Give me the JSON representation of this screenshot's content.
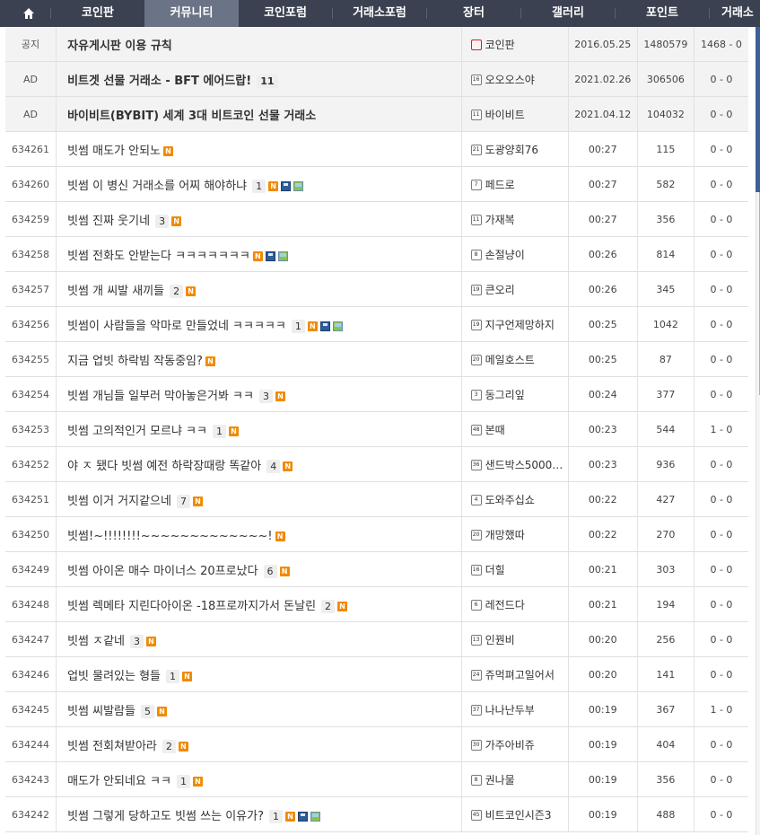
{
  "nav": {
    "items": [
      {
        "label": "코인판",
        "active": false
      },
      {
        "label": "커뮤니티",
        "active": true
      },
      {
        "label": "코인포럼",
        "active": false
      },
      {
        "label": "거래소포럼",
        "active": false
      },
      {
        "label": "장터",
        "active": false
      },
      {
        "label": "갤러리",
        "active": false
      },
      {
        "label": "포인트",
        "active": false
      },
      {
        "label": "거래소",
        "active": false
      }
    ]
  },
  "posts": [
    {
      "num": "공지",
      "title": "자유게시판 이용 규칙",
      "comments": "",
      "icons": [],
      "level": "ad",
      "author": "코인판",
      "date": "2016.05.25",
      "views": "1480579",
      "votes": "1468 - 0",
      "special": true
    },
    {
      "num": "AD",
      "title": "비트겟 선물 거래소 - BFT 에어드랍!",
      "comments": "11",
      "icons": [],
      "level": "16",
      "author": "오오오스야",
      "date": "2021.02.26",
      "views": "306506",
      "votes": "0 - 0",
      "special": true
    },
    {
      "num": "AD",
      "title": "바이비트(BYBIT) 세계 3대 비트코인 선물 거래소",
      "comments": "",
      "icons": [],
      "level": "11",
      "author": "바이비트",
      "date": "2021.04.12",
      "views": "104032",
      "votes": "0 - 0",
      "special": true
    },
    {
      "num": "634261",
      "title": "빗썸 매도가 안되노",
      "comments": "",
      "icons": [
        "new"
      ],
      "level": "21",
      "author": "도광양회76",
      "date": "00:27",
      "views": "115",
      "votes": "0 - 0"
    },
    {
      "num": "634260",
      "title": "빗썸 이 병신 거래소를 어찌 해야하냐",
      "comments": "1",
      "icons": [
        "new",
        "disk",
        "img"
      ],
      "level": "7",
      "author": "페드로",
      "date": "00:27",
      "views": "582",
      "votes": "0 - 0"
    },
    {
      "num": "634259",
      "title": "빗썸 진짜 웃기네",
      "comments": "3",
      "icons": [
        "new"
      ],
      "level": "11",
      "author": "가재복",
      "date": "00:27",
      "views": "356",
      "votes": "0 - 0"
    },
    {
      "num": "634258",
      "title": "빗썸 전화도 안받는다 ㅋㅋㅋㅋㅋㅋㅋ",
      "comments": "",
      "icons": [
        "new",
        "disk",
        "img"
      ],
      "level": "8",
      "author": "손절냥이",
      "date": "00:26",
      "views": "814",
      "votes": "0 - 0"
    },
    {
      "num": "634257",
      "title": "빗썸 개 씨발 새끼들",
      "comments": "2",
      "icons": [
        "new"
      ],
      "level": "19",
      "author": "큰오리",
      "date": "00:26",
      "views": "345",
      "votes": "0 - 0"
    },
    {
      "num": "634256",
      "title": "빗썸이 사람들을 악마로 만들었네 ㅋㅋㅋㅋㅋ",
      "comments": "1",
      "icons": [
        "new",
        "disk",
        "img"
      ],
      "level": "19",
      "author": "지구언제망하지",
      "date": "00:25",
      "views": "1042",
      "votes": "0 - 0"
    },
    {
      "num": "634255",
      "title": "지금 업빗 하락빔 작동중임?",
      "comments": "",
      "icons": [
        "new"
      ],
      "level": "20",
      "author": "메일호스트",
      "date": "00:25",
      "views": "87",
      "votes": "0 - 0"
    },
    {
      "num": "634254",
      "title": "빗썸 개님들 일부러 막아놓은거봐 ㅋㅋ",
      "comments": "3",
      "icons": [
        "new"
      ],
      "level": "3",
      "author": "동그리잎",
      "date": "00:24",
      "views": "377",
      "votes": "0 - 0"
    },
    {
      "num": "634253",
      "title": "빗썸 고의적인거 모르냐 ㅋㅋ",
      "comments": "1",
      "icons": [
        "new"
      ],
      "level": "48",
      "author": "본때",
      "date": "00:23",
      "views": "544",
      "votes": "1 - 0"
    },
    {
      "num": "634252",
      "title": "야 ㅈ 됐다 빗썸 예전 하락장때랑 똑같아",
      "comments": "4",
      "icons": [
        "new"
      ],
      "level": "36",
      "author": "샌드박스5000…",
      "date": "00:23",
      "views": "936",
      "votes": "0 - 0"
    },
    {
      "num": "634251",
      "title": "빗썸 이거 거지같으네",
      "comments": "7",
      "icons": [
        "new"
      ],
      "level": "4",
      "author": "도와주십쇼",
      "date": "00:22",
      "views": "427",
      "votes": "0 - 0"
    },
    {
      "num": "634250",
      "title": "빗썸!~!!!!!!!!~~~~~~~~~~~~~!",
      "comments": "",
      "icons": [
        "new"
      ],
      "level": "20",
      "author": "개망했따",
      "date": "00:22",
      "views": "270",
      "votes": "0 - 0"
    },
    {
      "num": "634249",
      "title": "빗썸 아이온 매수 마이너스 20프로났다",
      "comments": "6",
      "icons": [
        "new"
      ],
      "level": "16",
      "author": "더힐",
      "date": "00:21",
      "views": "303",
      "votes": "0 - 0"
    },
    {
      "num": "634248",
      "title": "빗썸 렉메타 지린다아이온 -18프로까지가서 돈날린",
      "comments": "2",
      "icons": [
        "new"
      ],
      "level": "6",
      "author": "레전드다",
      "date": "00:21",
      "views": "194",
      "votes": "0 - 0"
    },
    {
      "num": "634247",
      "title": "빗썸 ㅈ같네",
      "comments": "3",
      "icons": [
        "new"
      ],
      "level": "13",
      "author": "인꿘비",
      "date": "00:20",
      "views": "256",
      "votes": "0 - 0"
    },
    {
      "num": "634246",
      "title": "업빗 물려있는 형들",
      "comments": "1",
      "icons": [
        "new"
      ],
      "level": "24",
      "author": "쥬먹펴고일어서",
      "date": "00:20",
      "views": "141",
      "votes": "0 - 0"
    },
    {
      "num": "634245",
      "title": "빗썸 씨발람들",
      "comments": "5",
      "icons": [
        "new"
      ],
      "level": "37",
      "author": "나나난두부",
      "date": "00:19",
      "views": "367",
      "votes": "1 - 0"
    },
    {
      "num": "634244",
      "title": "빗썸 전회쳐받아라",
      "comments": "2",
      "icons": [
        "new"
      ],
      "level": "30",
      "author": "가주아비쥬",
      "date": "00:19",
      "views": "404",
      "votes": "0 - 0"
    },
    {
      "num": "634243",
      "title": "매도가 안되네요 ㅋㅋ",
      "comments": "1",
      "icons": [
        "new"
      ],
      "level": "8",
      "author": "권나물",
      "date": "00:19",
      "views": "356",
      "votes": "0 - 0"
    },
    {
      "num": "634242",
      "title": "빗썸 그렇게 당하고도 빗썸 쓰는 이유가?",
      "comments": "1",
      "icons": [
        "new",
        "disk",
        "img"
      ],
      "level": "45",
      "author": "비트코인시즌3",
      "date": "00:19",
      "views": "488",
      "votes": "0 - 0"
    }
  ],
  "icons": {
    "new_label": "N"
  }
}
